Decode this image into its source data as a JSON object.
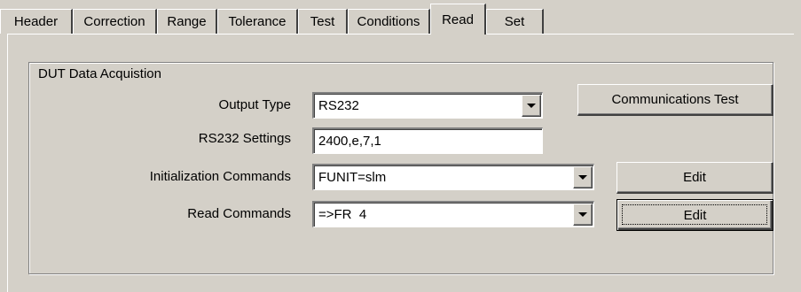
{
  "tabs": [
    {
      "label": "Header"
    },
    {
      "label": "Correction"
    },
    {
      "label": "Range"
    },
    {
      "label": "Tolerance"
    },
    {
      "label": "Test"
    },
    {
      "label": "Conditions"
    },
    {
      "label": "Read",
      "active": true
    },
    {
      "label": "Set"
    }
  ],
  "group": {
    "title": "DUT Data Acquistion",
    "output_type": {
      "label": "Output Type",
      "value": "RS232"
    },
    "rs232_settings": {
      "label": "RS232 Settings",
      "value": "2400,e,7,1"
    },
    "init_commands": {
      "label": "Initialization Commands",
      "value": "FUNIT=slm"
    },
    "read_commands": {
      "label": "Read Commands",
      "value": "=>FR  4"
    },
    "comm_test_button": "Communications Test",
    "edit_init_button": "Edit",
    "edit_read_button": "Edit"
  },
  "colors": {
    "face": "#d4d0c8",
    "highlight": "#ffffff",
    "shadow": "#808080",
    "dark_shadow": "#404040"
  }
}
